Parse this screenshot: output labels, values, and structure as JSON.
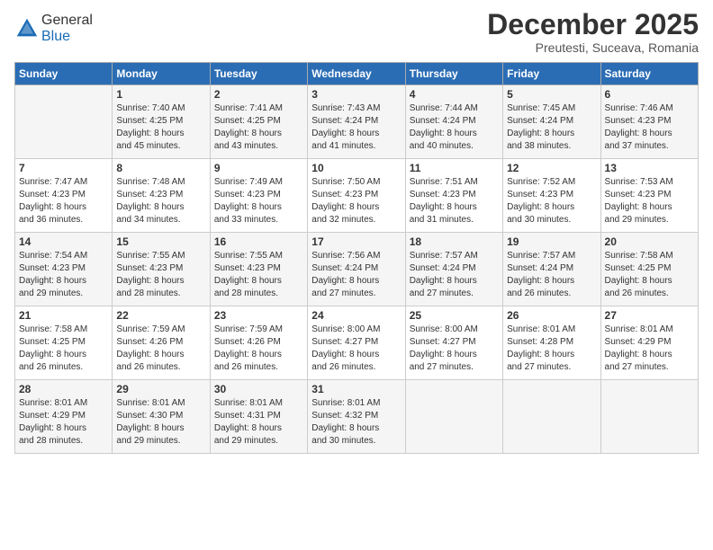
{
  "header": {
    "logo_general": "General",
    "logo_blue": "Blue",
    "month_title": "December 2025",
    "subtitle": "Preutesti, Suceava, Romania"
  },
  "days_of_week": [
    "Sunday",
    "Monday",
    "Tuesday",
    "Wednesday",
    "Thursday",
    "Friday",
    "Saturday"
  ],
  "weeks": [
    [
      {
        "day": "",
        "info": ""
      },
      {
        "day": "1",
        "info": "Sunrise: 7:40 AM\nSunset: 4:25 PM\nDaylight: 8 hours\nand 45 minutes."
      },
      {
        "day": "2",
        "info": "Sunrise: 7:41 AM\nSunset: 4:25 PM\nDaylight: 8 hours\nand 43 minutes."
      },
      {
        "day": "3",
        "info": "Sunrise: 7:43 AM\nSunset: 4:24 PM\nDaylight: 8 hours\nand 41 minutes."
      },
      {
        "day": "4",
        "info": "Sunrise: 7:44 AM\nSunset: 4:24 PM\nDaylight: 8 hours\nand 40 minutes."
      },
      {
        "day": "5",
        "info": "Sunrise: 7:45 AM\nSunset: 4:24 PM\nDaylight: 8 hours\nand 38 minutes."
      },
      {
        "day": "6",
        "info": "Sunrise: 7:46 AM\nSunset: 4:23 PM\nDaylight: 8 hours\nand 37 minutes."
      }
    ],
    [
      {
        "day": "7",
        "info": "Sunrise: 7:47 AM\nSunset: 4:23 PM\nDaylight: 8 hours\nand 36 minutes."
      },
      {
        "day": "8",
        "info": "Sunrise: 7:48 AM\nSunset: 4:23 PM\nDaylight: 8 hours\nand 34 minutes."
      },
      {
        "day": "9",
        "info": "Sunrise: 7:49 AM\nSunset: 4:23 PM\nDaylight: 8 hours\nand 33 minutes."
      },
      {
        "day": "10",
        "info": "Sunrise: 7:50 AM\nSunset: 4:23 PM\nDaylight: 8 hours\nand 32 minutes."
      },
      {
        "day": "11",
        "info": "Sunrise: 7:51 AM\nSunset: 4:23 PM\nDaylight: 8 hours\nand 31 minutes."
      },
      {
        "day": "12",
        "info": "Sunrise: 7:52 AM\nSunset: 4:23 PM\nDaylight: 8 hours\nand 30 minutes."
      },
      {
        "day": "13",
        "info": "Sunrise: 7:53 AM\nSunset: 4:23 PM\nDaylight: 8 hours\nand 29 minutes."
      }
    ],
    [
      {
        "day": "14",
        "info": "Sunrise: 7:54 AM\nSunset: 4:23 PM\nDaylight: 8 hours\nand 29 minutes."
      },
      {
        "day": "15",
        "info": "Sunrise: 7:55 AM\nSunset: 4:23 PM\nDaylight: 8 hours\nand 28 minutes."
      },
      {
        "day": "16",
        "info": "Sunrise: 7:55 AM\nSunset: 4:23 PM\nDaylight: 8 hours\nand 28 minutes."
      },
      {
        "day": "17",
        "info": "Sunrise: 7:56 AM\nSunset: 4:24 PM\nDaylight: 8 hours\nand 27 minutes."
      },
      {
        "day": "18",
        "info": "Sunrise: 7:57 AM\nSunset: 4:24 PM\nDaylight: 8 hours\nand 27 minutes."
      },
      {
        "day": "19",
        "info": "Sunrise: 7:57 AM\nSunset: 4:24 PM\nDaylight: 8 hours\nand 26 minutes."
      },
      {
        "day": "20",
        "info": "Sunrise: 7:58 AM\nSunset: 4:25 PM\nDaylight: 8 hours\nand 26 minutes."
      }
    ],
    [
      {
        "day": "21",
        "info": "Sunrise: 7:58 AM\nSunset: 4:25 PM\nDaylight: 8 hours\nand 26 minutes."
      },
      {
        "day": "22",
        "info": "Sunrise: 7:59 AM\nSunset: 4:26 PM\nDaylight: 8 hours\nand 26 minutes."
      },
      {
        "day": "23",
        "info": "Sunrise: 7:59 AM\nSunset: 4:26 PM\nDaylight: 8 hours\nand 26 minutes."
      },
      {
        "day": "24",
        "info": "Sunrise: 8:00 AM\nSunset: 4:27 PM\nDaylight: 8 hours\nand 26 minutes."
      },
      {
        "day": "25",
        "info": "Sunrise: 8:00 AM\nSunset: 4:27 PM\nDaylight: 8 hours\nand 27 minutes."
      },
      {
        "day": "26",
        "info": "Sunrise: 8:01 AM\nSunset: 4:28 PM\nDaylight: 8 hours\nand 27 minutes."
      },
      {
        "day": "27",
        "info": "Sunrise: 8:01 AM\nSunset: 4:29 PM\nDaylight: 8 hours\nand 27 minutes."
      }
    ],
    [
      {
        "day": "28",
        "info": "Sunrise: 8:01 AM\nSunset: 4:29 PM\nDaylight: 8 hours\nand 28 minutes."
      },
      {
        "day": "29",
        "info": "Sunrise: 8:01 AM\nSunset: 4:30 PM\nDaylight: 8 hours\nand 29 minutes."
      },
      {
        "day": "30",
        "info": "Sunrise: 8:01 AM\nSunset: 4:31 PM\nDaylight: 8 hours\nand 29 minutes."
      },
      {
        "day": "31",
        "info": "Sunrise: 8:01 AM\nSunset: 4:32 PM\nDaylight: 8 hours\nand 30 minutes."
      },
      {
        "day": "",
        "info": ""
      },
      {
        "day": "",
        "info": ""
      },
      {
        "day": "",
        "info": ""
      }
    ]
  ]
}
